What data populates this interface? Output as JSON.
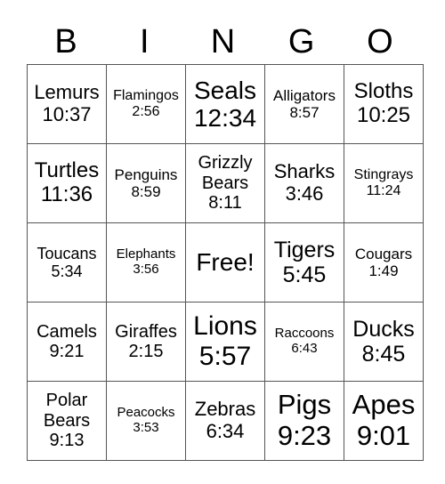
{
  "header": [
    "B",
    "I",
    "N",
    "G",
    "O"
  ],
  "rows": [
    [
      {
        "text": "Lemurs\n10:37",
        "size": 22
      },
      {
        "text": "Flamingos\n2:56",
        "size": 16
      },
      {
        "text": "Seals\n12:34",
        "size": 28
      },
      {
        "text": "Alligators\n8:57",
        "size": 17
      },
      {
        "text": "Sloths\n10:25",
        "size": 24
      }
    ],
    [
      {
        "text": "Turtles\n11:36",
        "size": 24
      },
      {
        "text": "Penguins\n8:59",
        "size": 17
      },
      {
        "text": "Grizzly\nBears\n8:11",
        "size": 20
      },
      {
        "text": "Sharks\n3:46",
        "size": 22
      },
      {
        "text": "Stingrays\n11:24",
        "size": 16
      }
    ],
    [
      {
        "text": "Toucans\n5:34",
        "size": 18
      },
      {
        "text": "Elephants\n3:56",
        "size": 15
      },
      {
        "text": "Free!",
        "size": 28
      },
      {
        "text": "Tigers\n5:45",
        "size": 25
      },
      {
        "text": "Cougars\n1:49",
        "size": 17
      }
    ],
    [
      {
        "text": "Camels\n9:21",
        "size": 20
      },
      {
        "text": "Giraffes\n2:15",
        "size": 20
      },
      {
        "text": "Lions\n5:57",
        "size": 30
      },
      {
        "text": "Raccoons\n6:43",
        "size": 15
      },
      {
        "text": "Ducks\n8:45",
        "size": 25
      }
    ],
    [
      {
        "text": "Polar\nBears\n9:13",
        "size": 20
      },
      {
        "text": "Peacocks\n3:53",
        "size": 15
      },
      {
        "text": "Zebras\n6:34",
        "size": 22
      },
      {
        "text": "Pigs\n9:23",
        "size": 31
      },
      {
        "text": "Apes\n9:01",
        "size": 31
      }
    ]
  ]
}
